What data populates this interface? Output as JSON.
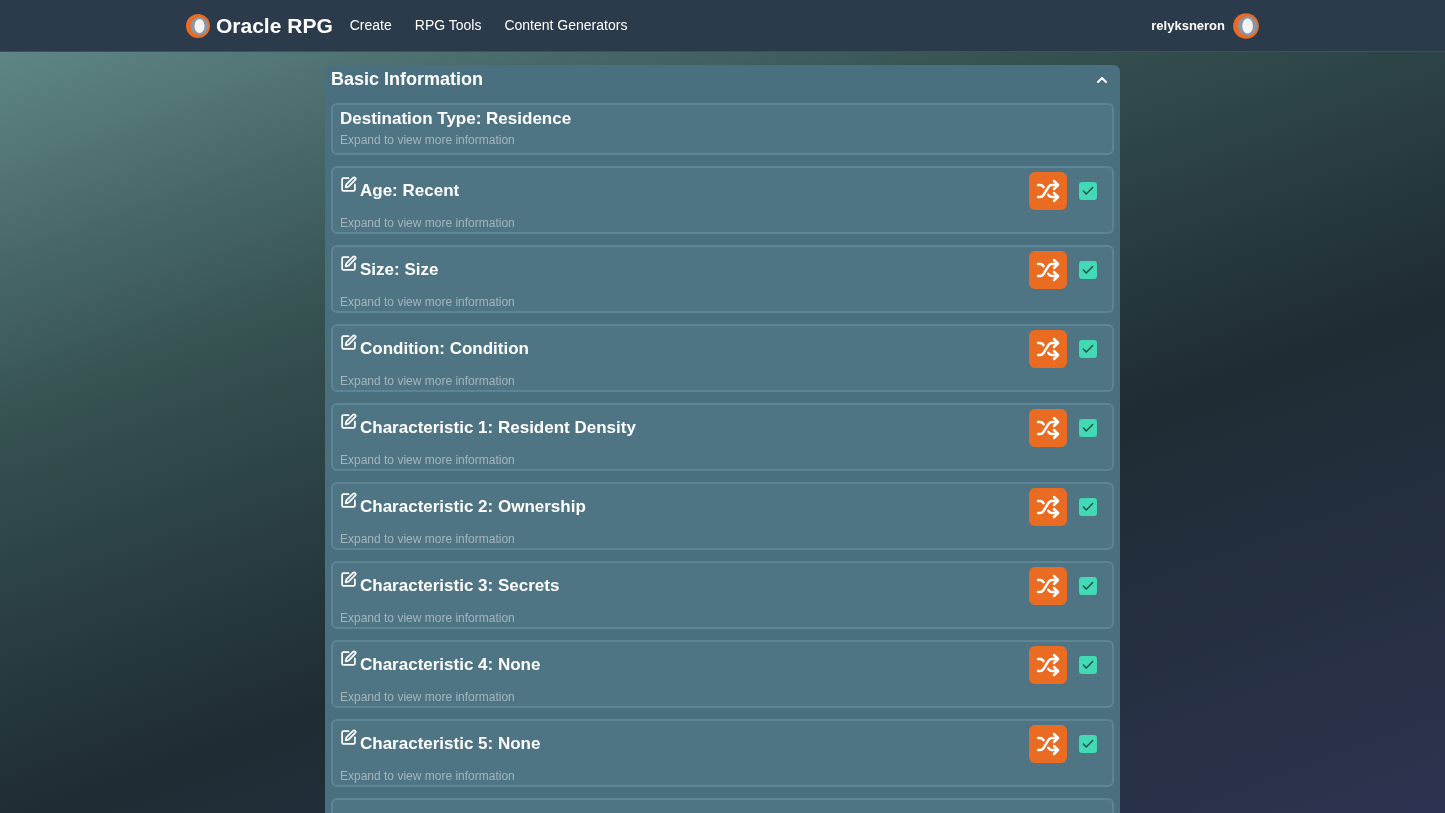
{
  "nav": {
    "brand": "Oracle RPG",
    "links": [
      "Create",
      "RPG Tools",
      "Content Generators"
    ],
    "user": "relyksneron"
  },
  "section": {
    "title": "Basic Information",
    "expanded": true,
    "items": [
      {
        "kind": "fixed",
        "title": "Destination Type: Residence",
        "subtitle": "Expand to view more information"
      },
      {
        "kind": "editable",
        "title": "Age: Recent",
        "subtitle": "Expand to view more information",
        "checked": true
      },
      {
        "kind": "editable",
        "title": "Size: Size",
        "subtitle": "Expand to view more information",
        "checked": true
      },
      {
        "kind": "editable",
        "title": "Condition: Condition",
        "subtitle": "Expand to view more information",
        "checked": true
      },
      {
        "kind": "editable",
        "title": "Characteristic 1: Resident Density",
        "subtitle": "Expand to view more information",
        "checked": true
      },
      {
        "kind": "editable",
        "title": "Characteristic 2: Ownership",
        "subtitle": "Expand to view more information",
        "checked": true
      },
      {
        "kind": "editable",
        "title": "Characteristic 3: Secrets",
        "subtitle": "Expand to view more information",
        "checked": true
      },
      {
        "kind": "editable",
        "title": "Characteristic 4: None",
        "subtitle": "Expand to view more information",
        "checked": true
      },
      {
        "kind": "editable",
        "title": "Characteristic 5: None",
        "subtitle": "Expand to view more information",
        "checked": true
      }
    ]
  }
}
